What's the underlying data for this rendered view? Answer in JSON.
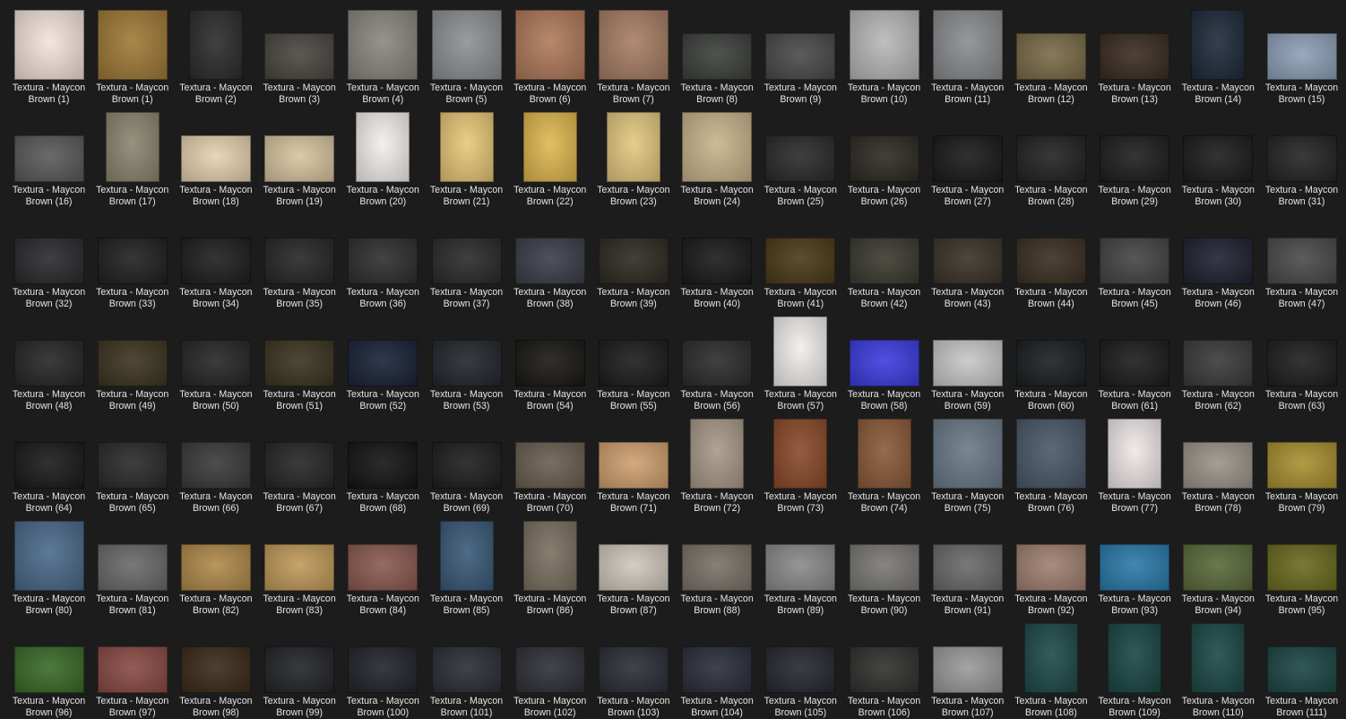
{
  "folder": {
    "caption_line1": "Textura - Maycon",
    "items": [
      {
        "label": "Brown (1)",
        "color": "#f4e3dc",
        "shape": "sq"
      },
      {
        "label": "Brown (1)",
        "color": "#a07a38",
        "shape": "sq"
      },
      {
        "label": "Brown (2)",
        "color": "#2c2c2c",
        "shape": "port"
      },
      {
        "label": "Brown (3)",
        "color": "#4b4640",
        "shape": "land"
      },
      {
        "label": "Brown (4)",
        "color": "#8a8780",
        "shape": "sq"
      },
      {
        "label": "Brown (5)",
        "color": "#8e9093",
        "shape": "sq"
      },
      {
        "label": "Brown (6)",
        "color": "#b07a5a",
        "shape": "sq"
      },
      {
        "label": "Brown (7)",
        "color": "#a77e64",
        "shape": "sq"
      },
      {
        "label": "Brown (8)",
        "color": "#3d403c",
        "shape": "land"
      },
      {
        "label": "Brown (9)",
        "color": "#4a4a4a",
        "shape": "land"
      },
      {
        "label": "Brown (10)",
        "color": "#b8b8b8",
        "shape": "sq"
      },
      {
        "label": "Brown (11)",
        "color": "#8a8c8f",
        "shape": "sq"
      },
      {
        "label": "Brown (12)",
        "color": "#7a6b48",
        "shape": "land"
      },
      {
        "label": "Brown (13)",
        "color": "#3a2c22",
        "shape": "land"
      },
      {
        "label": "Brown (14)",
        "color": "#1e2a3a",
        "shape": "port"
      },
      {
        "label": "Brown (15)",
        "color": "#8ea0b8",
        "shape": "land"
      },
      {
        "label": "Brown (16)",
        "color": "#5a5a5a",
        "shape": "land"
      },
      {
        "label": "Brown (17)",
        "color": "#8c8670",
        "shape": "port"
      },
      {
        "label": "Brown (18)",
        "color": "#e6d2b0",
        "shape": "land"
      },
      {
        "label": "Brown (19)",
        "color": "#d8c4a0",
        "shape": "land"
      },
      {
        "label": "Brown (20)",
        "color": "#f4f0ec",
        "shape": "port"
      },
      {
        "label": "Brown (21)",
        "color": "#e8c878",
        "shape": "port"
      },
      {
        "label": "Brown (22)",
        "color": "#e0b850",
        "shape": "port"
      },
      {
        "label": "Brown (23)",
        "color": "#e4c880",
        "shape": "port"
      },
      {
        "label": "Brown (24)",
        "color": "#c8b48c",
        "shape": "sq"
      },
      {
        "label": "Brown (25)",
        "color": "#2a2a2a",
        "shape": "land"
      },
      {
        "label": "Brown (26)",
        "color": "#2e2a24",
        "shape": "land"
      },
      {
        "label": "Brown (27)",
        "color": "#1a1a1a",
        "shape": "land"
      },
      {
        "label": "Brown (28)",
        "color": "#222222",
        "shape": "land"
      },
      {
        "label": "Brown (29)",
        "color": "#1e1e1e",
        "shape": "land"
      },
      {
        "label": "Brown (30)",
        "color": "#1c1c1c",
        "shape": "land"
      },
      {
        "label": "Brown (31)",
        "color": "#242424",
        "shape": "land"
      },
      {
        "label": "Brown (32)",
        "color": "#2a2a2e",
        "shape": "land"
      },
      {
        "label": "Brown (33)",
        "color": "#202020",
        "shape": "land"
      },
      {
        "label": "Brown (34)",
        "color": "#1e1e1e",
        "shape": "land"
      },
      {
        "label": "Brown (35)",
        "color": "#262626",
        "shape": "land"
      },
      {
        "label": "Brown (36)",
        "color": "#2e2e2e",
        "shape": "land"
      },
      {
        "label": "Brown (37)",
        "color": "#2a2a2a",
        "shape": "land"
      },
      {
        "label": "Brown (38)",
        "color": "#3a3e48",
        "shape": "land"
      },
      {
        "label": "Brown (39)",
        "color": "#2e2a22",
        "shape": "land"
      },
      {
        "label": "Brown (40)",
        "color": "#1a1a1a",
        "shape": "land"
      },
      {
        "label": "Brown (41)",
        "color": "#4a3a18",
        "shape": "land"
      },
      {
        "label": "Brown (42)",
        "color": "#3a3a30",
        "shape": "land"
      },
      {
        "label": "Brown (43)",
        "color": "#3a3228",
        "shape": "land"
      },
      {
        "label": "Brown (44)",
        "color": "#3a2e22",
        "shape": "land"
      },
      {
        "label": "Brown (45)",
        "color": "#444444",
        "shape": "land"
      },
      {
        "label": "Brown (46)",
        "color": "#1e2230",
        "shape": "land"
      },
      {
        "label": "Brown (47)",
        "color": "#4a4a4a",
        "shape": "land"
      },
      {
        "label": "Brown (48)",
        "color": "#262626",
        "shape": "land"
      },
      {
        "label": "Brown (49)",
        "color": "#3c3420",
        "shape": "land"
      },
      {
        "label": "Brown (50)",
        "color": "#262626",
        "shape": "land"
      },
      {
        "label": "Brown (51)",
        "color": "#3a3420",
        "shape": "land"
      },
      {
        "label": "Brown (52)",
        "color": "#1a2238",
        "shape": "land"
      },
      {
        "label": "Brown (53)",
        "color": "#22262c",
        "shape": "land"
      },
      {
        "label": "Brown (54)",
        "color": "#1a1814",
        "shape": "land"
      },
      {
        "label": "Brown (55)",
        "color": "#1c1c1c",
        "shape": "land"
      },
      {
        "label": "Brown (56)",
        "color": "#2c2c2c",
        "shape": "land"
      },
      {
        "label": "Brown (57)",
        "color": "#f2eeee",
        "shape": "port"
      },
      {
        "label": "Brown (58)",
        "color": "#3c3ce0",
        "shape": "land"
      },
      {
        "label": "Brown (59)",
        "color": "#c8c8c8",
        "shape": "land"
      },
      {
        "label": "Brown (60)",
        "color": "#1a1e22",
        "shape": "land"
      },
      {
        "label": "Brown (61)",
        "color": "#1c1c1c",
        "shape": "land"
      },
      {
        "label": "Brown (62)",
        "color": "#3a3a3a",
        "shape": "land"
      },
      {
        "label": "Brown (63)",
        "color": "#1e1e1e",
        "shape": "land"
      },
      {
        "label": "Brown (64)",
        "color": "#1a1a1a",
        "shape": "land"
      },
      {
        "label": "Brown (65)",
        "color": "#2a2a2a",
        "shape": "land"
      },
      {
        "label": "Brown (66)",
        "color": "#3a3a3a",
        "shape": "land"
      },
      {
        "label": "Brown (67)",
        "color": "#262626",
        "shape": "land"
      },
      {
        "label": "Brown (68)",
        "color": "#141414",
        "shape": "land"
      },
      {
        "label": "Brown (69)",
        "color": "#1e1e1e",
        "shape": "land"
      },
      {
        "label": "Brown (70)",
        "color": "#6a5e50",
        "shape": "land"
      },
      {
        "label": "Brown (71)",
        "color": "#d0a070",
        "shape": "land"
      },
      {
        "label": "Brown (72)",
        "color": "#a89a88",
        "shape": "port"
      },
      {
        "label": "Brown (73)",
        "color": "#8a4a2a",
        "shape": "port"
      },
      {
        "label": "Brown (74)",
        "color": "#8a5a3a",
        "shape": "port"
      },
      {
        "label": "Brown (75)",
        "color": "#6a7a88",
        "shape": "sq"
      },
      {
        "label": "Brown (76)",
        "color": "#4a5868",
        "shape": "sq"
      },
      {
        "label": "Brown (77)",
        "color": "#f0e8e8",
        "shape": "port"
      },
      {
        "label": "Brown (78)",
        "color": "#9a948a",
        "shape": "land"
      },
      {
        "label": "Brown (79)",
        "color": "#a89030",
        "shape": "land"
      },
      {
        "label": "Brown (80)",
        "color": "#4a6a8a",
        "shape": "sq"
      },
      {
        "label": "Brown (81)",
        "color": "#6a6a6a",
        "shape": "land"
      },
      {
        "label": "Brown (82)",
        "color": "#b08a4a",
        "shape": "land"
      },
      {
        "label": "Brown (83)",
        "color": "#c09a5a",
        "shape": "land"
      },
      {
        "label": "Brown (84)",
        "color": "#8a5a50",
        "shape": "land"
      },
      {
        "label": "Brown (85)",
        "color": "#3a5a78",
        "shape": "port"
      },
      {
        "label": "Brown (86)",
        "color": "#7a7060",
        "shape": "port"
      },
      {
        "label": "Brown (87)",
        "color": "#d0c8bc",
        "shape": "land"
      },
      {
        "label": "Brown (88)",
        "color": "#7a7268",
        "shape": "land"
      },
      {
        "label": "Brown (89)",
        "color": "#8a8a8a",
        "shape": "land"
      },
      {
        "label": "Brown (90)",
        "color": "#7a7874",
        "shape": "land"
      },
      {
        "label": "Brown (91)",
        "color": "#6a6a6a",
        "shape": "land"
      },
      {
        "label": "Brown (92)",
        "color": "#a08070",
        "shape": "land"
      },
      {
        "label": "Brown (93)",
        "color": "#2a7aaa",
        "shape": "land"
      },
      {
        "label": "Brown (94)",
        "color": "#5a6a3a",
        "shape": "land"
      },
      {
        "label": "Brown (95)",
        "color": "#6a6a20",
        "shape": "land"
      },
      {
        "label": "Brown (96)",
        "color": "#3a6a28",
        "shape": "land"
      },
      {
        "label": "Brown (97)",
        "color": "#8a4a44",
        "shape": "land"
      },
      {
        "label": "Brown (98)",
        "color": "#3a2a1a",
        "shape": "land"
      },
      {
        "label": "Brown (99)",
        "color": "#222428",
        "shape": "land"
      },
      {
        "label": "Brown (100)",
        "color": "#22242a",
        "shape": "land"
      },
      {
        "label": "Brown (101)",
        "color": "#2a2e34",
        "shape": "land"
      },
      {
        "label": "Brown (102)",
        "color": "#2e3036",
        "shape": "land"
      },
      {
        "label": "Brown (103)",
        "color": "#2a2e36",
        "shape": "land"
      },
      {
        "label": "Brown (104)",
        "color": "#2a2e38",
        "shape": "land"
      },
      {
        "label": "Brown (105)",
        "color": "#262830",
        "shape": "land"
      },
      {
        "label": "Brown (106)",
        "color": "#30302e",
        "shape": "land"
      },
      {
        "label": "Brown (107)",
        "color": "#9a9a9a",
        "shape": "land"
      },
      {
        "label": "Brown (108)",
        "color": "#1e4a48",
        "shape": "port"
      },
      {
        "label": "Brown (109)",
        "color": "#1a4644",
        "shape": "port"
      },
      {
        "label": "Brown (110)",
        "color": "#1c4846",
        "shape": "port"
      },
      {
        "label": "Brown (111)",
        "color": "#1c4644",
        "shape": "land"
      }
    ]
  }
}
